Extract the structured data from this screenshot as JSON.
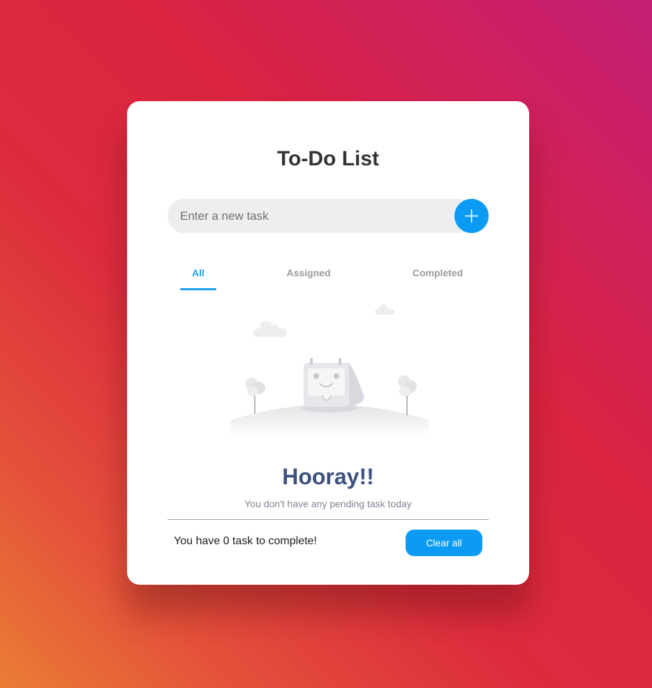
{
  "app": {
    "title": "To-Do List"
  },
  "input": {
    "placeholder": "Enter a new task",
    "value": "",
    "add_icon": "plus-icon"
  },
  "tabs": [
    {
      "label": "All",
      "active": true
    },
    {
      "label": "Assigned",
      "active": false
    },
    {
      "label": "Completed",
      "active": false
    }
  ],
  "empty_state": {
    "illustration": "happy-calendar-on-hill",
    "heading": "Hooray!!",
    "message": "You don't have any pending task today"
  },
  "footer": {
    "count_text": "You have 0 task to complete!",
    "clear_label": "Clear all"
  },
  "colors": {
    "accent": "#0b9bf5",
    "heading": "#3d5080",
    "title": "#333333"
  }
}
